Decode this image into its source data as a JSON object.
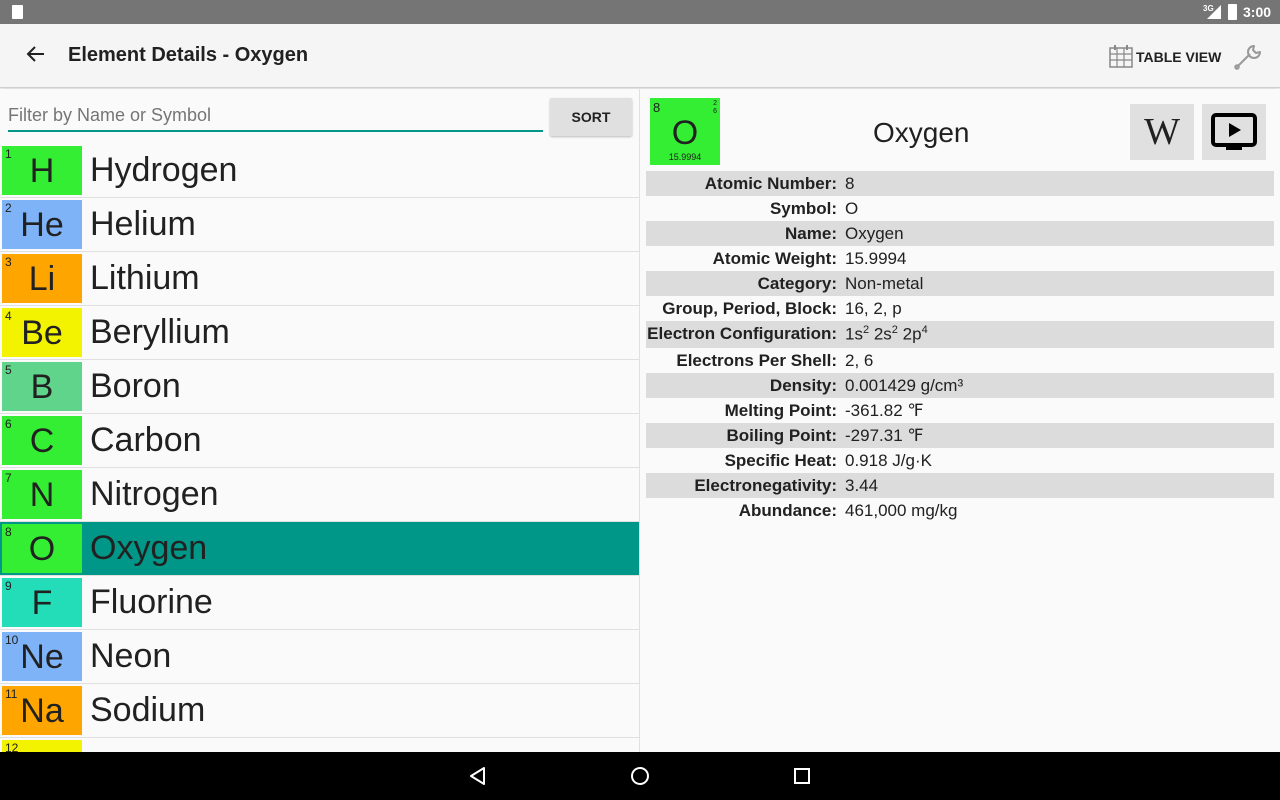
{
  "status": {
    "network": "3G",
    "time": "3:00"
  },
  "toolbar": {
    "title": "Element Details - Oxygen",
    "table_view_label": "TABLE VIEW"
  },
  "filter": {
    "placeholder": "Filter by Name or Symbol",
    "sort_label": "SORT"
  },
  "elements": [
    {
      "number": "1",
      "symbol": "H",
      "name": "Hydrogen",
      "color": "#33ee33"
    },
    {
      "number": "2",
      "symbol": "He",
      "name": "Helium",
      "color": "#7fb3f7"
    },
    {
      "number": "3",
      "symbol": "Li",
      "name": "Lithium",
      "color": "#ffa500"
    },
    {
      "number": "4",
      "symbol": "Be",
      "name": "Beryllium",
      "color": "#f3f300"
    },
    {
      "number": "5",
      "symbol": "B",
      "name": "Boron",
      "color": "#5fd48a"
    },
    {
      "number": "6",
      "symbol": "C",
      "name": "Carbon",
      "color": "#33ee33"
    },
    {
      "number": "7",
      "symbol": "N",
      "name": "Nitrogen",
      "color": "#33ee33"
    },
    {
      "number": "8",
      "symbol": "O",
      "name": "Oxygen",
      "color": "#33ee33",
      "selected": true
    },
    {
      "number": "9",
      "symbol": "F",
      "name": "Fluorine",
      "color": "#22ddb8"
    },
    {
      "number": "10",
      "symbol": "Ne",
      "name": "Neon",
      "color": "#7fb3f7"
    },
    {
      "number": "11",
      "symbol": "Na",
      "name": "Sodium",
      "color": "#ffa500"
    },
    {
      "number": "12",
      "symbol": "",
      "name": "",
      "color": "#f3f300"
    }
  ],
  "detail": {
    "number": "8",
    "symbol": "O",
    "weight": "15.9994",
    "shells": [
      "2",
      "6"
    ],
    "name": "Oxygen",
    "tile_color": "#33ee33",
    "properties": [
      {
        "label": "Atomic Number:",
        "value": "8"
      },
      {
        "label": "Symbol:",
        "value": "O"
      },
      {
        "label": "Name:",
        "value": "Oxygen"
      },
      {
        "label": "Atomic Weight:",
        "value": "15.9994"
      },
      {
        "label": "Category:",
        "value": "Non-metal"
      },
      {
        "label": "Group, Period, Block:",
        "value": "16, 2, p"
      },
      {
        "label": "Electron Configuration:",
        "value": "1s2 2s2 2p4"
      },
      {
        "label": "Electrons Per Shell:",
        "value": "2, 6"
      },
      {
        "label": "Density:",
        "value": "0.001429 g/cm³"
      },
      {
        "label": "Melting Point:",
        "value": "-361.82 ℉"
      },
      {
        "label": "Boiling Point:",
        "value": "-297.31 ℉"
      },
      {
        "label": "Specific Heat:",
        "value": "0.918 J/g·K"
      },
      {
        "label": "Electronegativity:",
        "value": "3.44"
      },
      {
        "label": "Abundance:",
        "value": "461,000 mg/kg"
      }
    ],
    "electron_config_parts": [
      {
        "base": "1s",
        "sup": "2"
      },
      {
        "base": "2s",
        "sup": "2"
      },
      {
        "base": "2p",
        "sup": "4"
      }
    ]
  },
  "icons": {
    "back": "arrow-left-icon",
    "table_view": "grid-icon",
    "settings": "wrench-icon",
    "wikipedia": "wikipedia-icon",
    "video": "play-video-icon",
    "nav_back": "triangle-back-icon",
    "nav_home": "circle-home-icon",
    "nav_recent": "square-recents-icon"
  },
  "colors": {
    "accent": "#009688",
    "selected_row": "#009688"
  }
}
